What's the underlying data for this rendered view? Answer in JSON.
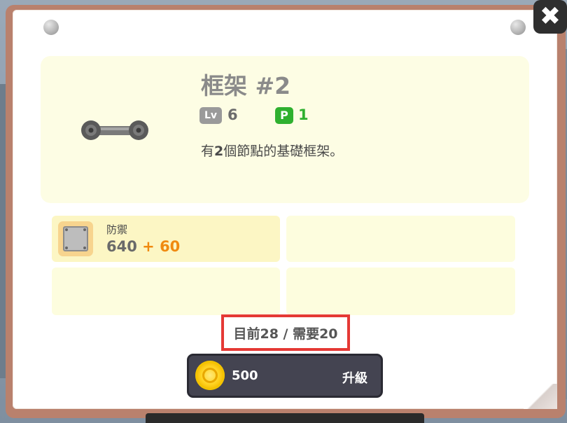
{
  "part": {
    "title": "框架 #2",
    "level_badge": "Lv",
    "level": "6",
    "points_badge": "P",
    "points": "1",
    "description_prefix": "有",
    "description_number": "2",
    "description_suffix": "個節點的基礎框架。",
    "icon": "frame-two-node-icon"
  },
  "stats": [
    {
      "label": "防禦",
      "base": "640",
      "bonus": "+ 60",
      "icon": "armor-plate-icon"
    }
  ],
  "progress": {
    "text": "目前28 / 需要20"
  },
  "upgrade": {
    "cost": "500",
    "label": "升級",
    "icon": "coin-icon"
  },
  "close": {
    "label": "✖"
  },
  "colors": {
    "panel": "#fdfde4",
    "bonus": "#f08a10",
    "points_green": "#2fb02f",
    "button": "#444451",
    "highlight": "#e53935"
  }
}
